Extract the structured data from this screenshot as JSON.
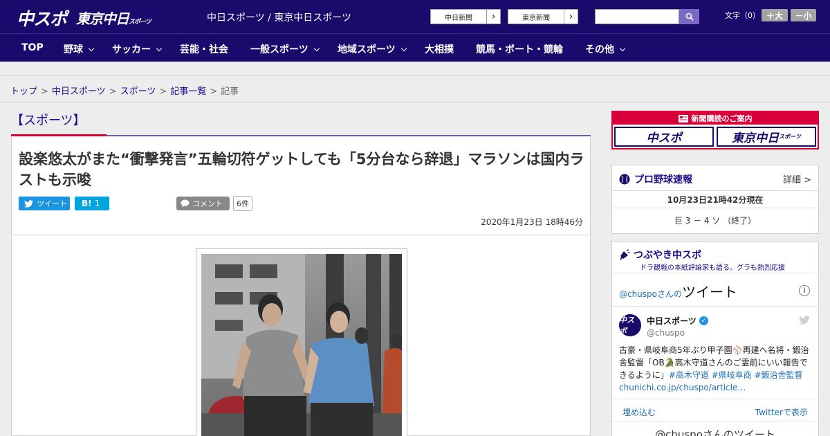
{
  "header": {
    "logo_chuspo": "中スポ",
    "logo_tokyo": "東京中日",
    "logo_tokyo_small": "スポーツ",
    "site_links": "中日スポーツ / 東京中日スポーツ",
    "chunichi_btn": "中日新聞",
    "tokyo_btn": "東京新聞",
    "search_placeholder": "",
    "fontsize_label": "文字（0）",
    "fontsize_plus": "＋大",
    "fontsize_minus": "－小",
    "colors": {
      "brand": "#1a0a6b",
      "accent": "#d9003a"
    }
  },
  "nav": {
    "items": [
      {
        "label": "TOP",
        "dropdown": false
      },
      {
        "label": "野球",
        "dropdown": true
      },
      {
        "label": "サッカー",
        "dropdown": true
      },
      {
        "label": "芸能・社会",
        "dropdown": false
      },
      {
        "label": "一般スポーツ",
        "dropdown": true
      },
      {
        "label": "地域スポーツ",
        "dropdown": true
      },
      {
        "label": "大相撲",
        "dropdown": false
      },
      {
        "label": "競馬・ボート・競輪",
        "dropdown": false
      },
      {
        "label": "その他",
        "dropdown": true
      }
    ]
  },
  "breadcrumb": {
    "items": [
      "トップ",
      "中日スポーツ",
      "スポーツ",
      "記事一覧"
    ],
    "separator": ">",
    "current": "記事"
  },
  "article": {
    "category": "【スポーツ】",
    "headline": "設楽悠太がまた“衝撃発言”五輪切符ゲットしても「5分台なら辞退」マラソンは国内ラストも示唆",
    "tweet_label": "ツイート",
    "hatena_label": "B!",
    "hatena_count": "1",
    "comment_label": "コメント",
    "comment_count": "6件",
    "date": "2020年1月23日 18時46分"
  },
  "sidebar": {
    "subscribe_label": "新聞購読のご案内",
    "subscribe_logo1": "中スポ",
    "subscribe_logo2": "東京中日",
    "subscribe_logo2_small": "スポーツ",
    "baseball": {
      "title": "プロ野球速報",
      "detail": "詳細 >",
      "time": "10月23日21時42分現在",
      "score": "巨 3 － 4 ソ （終了）"
    },
    "tweet_widget": {
      "title": "つぶやき中スポ",
      "subtitle": "ドラ観戦の本紙評論家も語る。グラも熱烈応援",
      "heading_handle": "@chuspoさんの",
      "heading_word": "ツイート",
      "account_name": "中日スポーツ",
      "account_handle": "@chuspo",
      "avatar_text": "中スポ",
      "body_text": "古豪・県岐阜商5年ぶり甲子園⚾再建へ名将・鍛治舎監督「OB🐊高木守道さんのご霊前にいい報告できるように」",
      "body_tags": "#高木守道 #県岐阜商 #鍛治舎監督",
      "body_link": "chunichi.co.jp/chuspo/article…",
      "embed_label": "埋め込む",
      "view_label": "Twitterで表示",
      "more_label": "@chuspoさんのツイート"
    }
  }
}
